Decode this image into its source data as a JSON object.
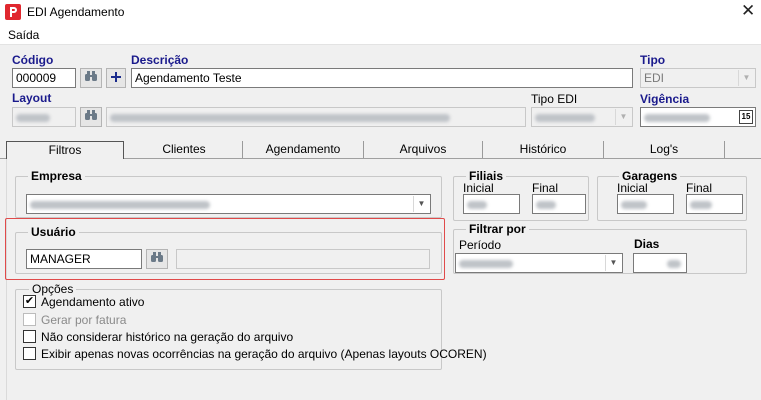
{
  "window": {
    "title": "EDI Agendamento",
    "close_glyph": "✕"
  },
  "menu": {
    "items": [
      "Saída"
    ]
  },
  "header": {
    "codigo_label": "Código",
    "codigo_value": "000009",
    "descricao_label": "Descrição",
    "descricao_value": "Agendamento Teste",
    "tipo_label": "Tipo",
    "tipo_value": "EDI",
    "layout_label": "Layout",
    "tipo_edi_label": "Tipo EDI",
    "vigencia_label": "Vigência",
    "calendar_day": "15"
  },
  "tabs": [
    {
      "label": "Filtros",
      "active": true
    },
    {
      "label": "Clientes",
      "active": false
    },
    {
      "label": "Agendamento",
      "active": false
    },
    {
      "label": "Arquivos",
      "active": false
    },
    {
      "label": "Histórico",
      "active": false
    },
    {
      "label": "Log's",
      "active": false
    }
  ],
  "filtros": {
    "empresa_label": "Empresa",
    "usuario_label": "Usuário",
    "usuario_value": "MANAGER",
    "filiais_label": "Filiais",
    "filiais_inicial": "Inicial",
    "filiais_final": "Final",
    "garagens_label": "Garagens",
    "garagens_inicial": "Inicial",
    "garagens_final": "Final",
    "filtrar_label": "Filtrar por",
    "periodo_label": "Período",
    "dias_label": "Dias",
    "opcoes_label": "Opções",
    "opcoes": [
      {
        "label": "Agendamento ativo",
        "checked": true,
        "enabled": true
      },
      {
        "label": "Gerar por fatura",
        "checked": false,
        "enabled": false
      },
      {
        "label": "Não considerar histórico na geração do arquivo",
        "checked": false,
        "enabled": true
      },
      {
        "label": "Exibir apenas novas ocorrências na geração do arquivo (Apenas layouts OCOREN)",
        "checked": false,
        "enabled": true
      }
    ]
  },
  "colors": {
    "label_blue": "#1a1a8c",
    "highlight": "#e04a4a",
    "app_icon": "#e0282f"
  }
}
